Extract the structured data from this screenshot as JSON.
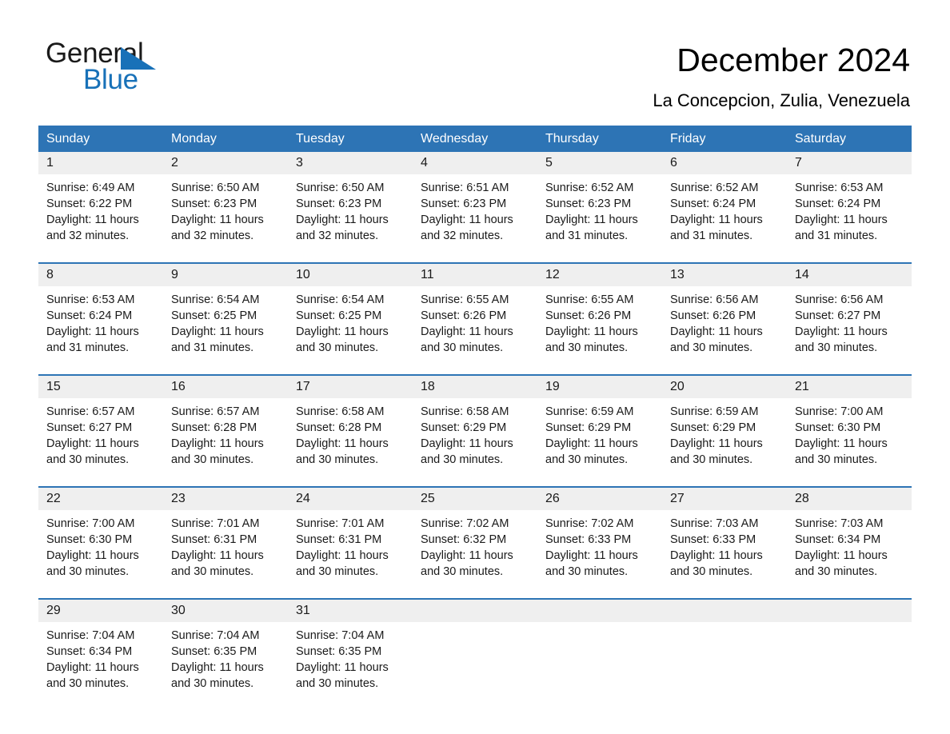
{
  "brand": {
    "name_part1": "General",
    "name_part2": "Blue",
    "accent_color": "#1871b8"
  },
  "header": {
    "month_title": "December 2024",
    "location": "La Concepcion, Zulia, Venezuela"
  },
  "calendar": {
    "header_color": "#2d74b5",
    "day_band_color": "#efefef",
    "weekday_headers": [
      "Sunday",
      "Monday",
      "Tuesday",
      "Wednesday",
      "Thursday",
      "Friday",
      "Saturday"
    ],
    "weeks": [
      [
        {
          "day": "1",
          "sunrise": "Sunrise: 6:49 AM",
          "sunset": "Sunset: 6:22 PM",
          "daylight": "Daylight: 11 hours and 32 minutes."
        },
        {
          "day": "2",
          "sunrise": "Sunrise: 6:50 AM",
          "sunset": "Sunset: 6:23 PM",
          "daylight": "Daylight: 11 hours and 32 minutes."
        },
        {
          "day": "3",
          "sunrise": "Sunrise: 6:50 AM",
          "sunset": "Sunset: 6:23 PM",
          "daylight": "Daylight: 11 hours and 32 minutes."
        },
        {
          "day": "4",
          "sunrise": "Sunrise: 6:51 AM",
          "sunset": "Sunset: 6:23 PM",
          "daylight": "Daylight: 11 hours and 32 minutes."
        },
        {
          "day": "5",
          "sunrise": "Sunrise: 6:52 AM",
          "sunset": "Sunset: 6:23 PM",
          "daylight": "Daylight: 11 hours and 31 minutes."
        },
        {
          "day": "6",
          "sunrise": "Sunrise: 6:52 AM",
          "sunset": "Sunset: 6:24 PM",
          "daylight": "Daylight: 11 hours and 31 minutes."
        },
        {
          "day": "7",
          "sunrise": "Sunrise: 6:53 AM",
          "sunset": "Sunset: 6:24 PM",
          "daylight": "Daylight: 11 hours and 31 minutes."
        }
      ],
      [
        {
          "day": "8",
          "sunrise": "Sunrise: 6:53 AM",
          "sunset": "Sunset: 6:24 PM",
          "daylight": "Daylight: 11 hours and 31 minutes."
        },
        {
          "day": "9",
          "sunrise": "Sunrise: 6:54 AM",
          "sunset": "Sunset: 6:25 PM",
          "daylight": "Daylight: 11 hours and 31 minutes."
        },
        {
          "day": "10",
          "sunrise": "Sunrise: 6:54 AM",
          "sunset": "Sunset: 6:25 PM",
          "daylight": "Daylight: 11 hours and 30 minutes."
        },
        {
          "day": "11",
          "sunrise": "Sunrise: 6:55 AM",
          "sunset": "Sunset: 6:26 PM",
          "daylight": "Daylight: 11 hours and 30 minutes."
        },
        {
          "day": "12",
          "sunrise": "Sunrise: 6:55 AM",
          "sunset": "Sunset: 6:26 PM",
          "daylight": "Daylight: 11 hours and 30 minutes."
        },
        {
          "day": "13",
          "sunrise": "Sunrise: 6:56 AM",
          "sunset": "Sunset: 6:26 PM",
          "daylight": "Daylight: 11 hours and 30 minutes."
        },
        {
          "day": "14",
          "sunrise": "Sunrise: 6:56 AM",
          "sunset": "Sunset: 6:27 PM",
          "daylight": "Daylight: 11 hours and 30 minutes."
        }
      ],
      [
        {
          "day": "15",
          "sunrise": "Sunrise: 6:57 AM",
          "sunset": "Sunset: 6:27 PM",
          "daylight": "Daylight: 11 hours and 30 minutes."
        },
        {
          "day": "16",
          "sunrise": "Sunrise: 6:57 AM",
          "sunset": "Sunset: 6:28 PM",
          "daylight": "Daylight: 11 hours and 30 minutes."
        },
        {
          "day": "17",
          "sunrise": "Sunrise: 6:58 AM",
          "sunset": "Sunset: 6:28 PM",
          "daylight": "Daylight: 11 hours and 30 minutes."
        },
        {
          "day": "18",
          "sunrise": "Sunrise: 6:58 AM",
          "sunset": "Sunset: 6:29 PM",
          "daylight": "Daylight: 11 hours and 30 minutes."
        },
        {
          "day": "19",
          "sunrise": "Sunrise: 6:59 AM",
          "sunset": "Sunset: 6:29 PM",
          "daylight": "Daylight: 11 hours and 30 minutes."
        },
        {
          "day": "20",
          "sunrise": "Sunrise: 6:59 AM",
          "sunset": "Sunset: 6:29 PM",
          "daylight": "Daylight: 11 hours and 30 minutes."
        },
        {
          "day": "21",
          "sunrise": "Sunrise: 7:00 AM",
          "sunset": "Sunset: 6:30 PM",
          "daylight": "Daylight: 11 hours and 30 minutes."
        }
      ],
      [
        {
          "day": "22",
          "sunrise": "Sunrise: 7:00 AM",
          "sunset": "Sunset: 6:30 PM",
          "daylight": "Daylight: 11 hours and 30 minutes."
        },
        {
          "day": "23",
          "sunrise": "Sunrise: 7:01 AM",
          "sunset": "Sunset: 6:31 PM",
          "daylight": "Daylight: 11 hours and 30 minutes."
        },
        {
          "day": "24",
          "sunrise": "Sunrise: 7:01 AM",
          "sunset": "Sunset: 6:31 PM",
          "daylight": "Daylight: 11 hours and 30 minutes."
        },
        {
          "day": "25",
          "sunrise": "Sunrise: 7:02 AM",
          "sunset": "Sunset: 6:32 PM",
          "daylight": "Daylight: 11 hours and 30 minutes."
        },
        {
          "day": "26",
          "sunrise": "Sunrise: 7:02 AM",
          "sunset": "Sunset: 6:33 PM",
          "daylight": "Daylight: 11 hours and 30 minutes."
        },
        {
          "day": "27",
          "sunrise": "Sunrise: 7:03 AM",
          "sunset": "Sunset: 6:33 PM",
          "daylight": "Daylight: 11 hours and 30 minutes."
        },
        {
          "day": "28",
          "sunrise": "Sunrise: 7:03 AM",
          "sunset": "Sunset: 6:34 PM",
          "daylight": "Daylight: 11 hours and 30 minutes."
        }
      ],
      [
        {
          "day": "29",
          "sunrise": "Sunrise: 7:04 AM",
          "sunset": "Sunset: 6:34 PM",
          "daylight": "Daylight: 11 hours and 30 minutes."
        },
        {
          "day": "30",
          "sunrise": "Sunrise: 7:04 AM",
          "sunset": "Sunset: 6:35 PM",
          "daylight": "Daylight: 11 hours and 30 minutes."
        },
        {
          "day": "31",
          "sunrise": "Sunrise: 7:04 AM",
          "sunset": "Sunset: 6:35 PM",
          "daylight": "Daylight: 11 hours and 30 minutes."
        },
        {
          "day": "",
          "sunrise": "",
          "sunset": "",
          "daylight": ""
        },
        {
          "day": "",
          "sunrise": "",
          "sunset": "",
          "daylight": ""
        },
        {
          "day": "",
          "sunrise": "",
          "sunset": "",
          "daylight": ""
        },
        {
          "day": "",
          "sunrise": "",
          "sunset": "",
          "daylight": ""
        }
      ]
    ]
  }
}
